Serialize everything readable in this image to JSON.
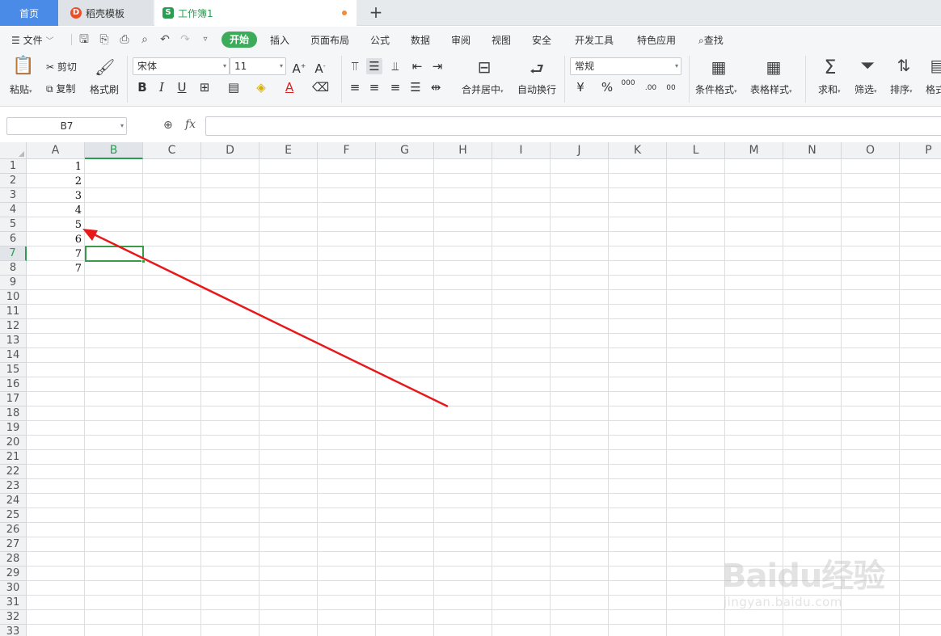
{
  "tabs": {
    "home": "首页",
    "template": "稻壳模板",
    "workbook": "工作簿1",
    "template_logo": "D",
    "workbook_logo": "S"
  },
  "menu": {
    "file": "文件",
    "items": [
      "开始",
      "插入",
      "页面布局",
      "公式",
      "数据",
      "审阅",
      "视图",
      "安全",
      "开发工具",
      "特色应用",
      "查找"
    ]
  },
  "ribbon": {
    "paste": "粘贴",
    "cut": "剪切",
    "copy": "复制",
    "format_painter": "格式刷",
    "font_name": "宋体",
    "font_size": "11",
    "merge_center": "合并居中",
    "wrap_text": "自动换行",
    "number_format": "常规",
    "conditional_format": "条件格式",
    "table_style": "表格样式",
    "sum": "求和",
    "filter": "筛选",
    "sort": "排序",
    "format": "格式",
    "decimal_1": ".00",
    "decimal_2": "00",
    "thousands": "000"
  },
  "formula_bar": {
    "name_box": "B7",
    "fx": "fx",
    "value": ""
  },
  "sheet": {
    "columns": [
      "A",
      "B",
      "C",
      "D",
      "E",
      "F",
      "G",
      "H",
      "I",
      "J",
      "K",
      "L",
      "M",
      "N",
      "O",
      "P"
    ],
    "selected_column": "B",
    "selected_row": 7,
    "row_count": 33,
    "column_a_values": [
      "1",
      "2",
      "3",
      "4",
      "5",
      "6",
      "7",
      "7"
    ]
  },
  "watermark": {
    "logo": "Baidu经验",
    "url": "jingyan.baidu.com"
  },
  "colors": {
    "accent_green": "#3cab5a",
    "home_tab_blue": "#4a8be8",
    "annotation_red": "#e8191b"
  }
}
